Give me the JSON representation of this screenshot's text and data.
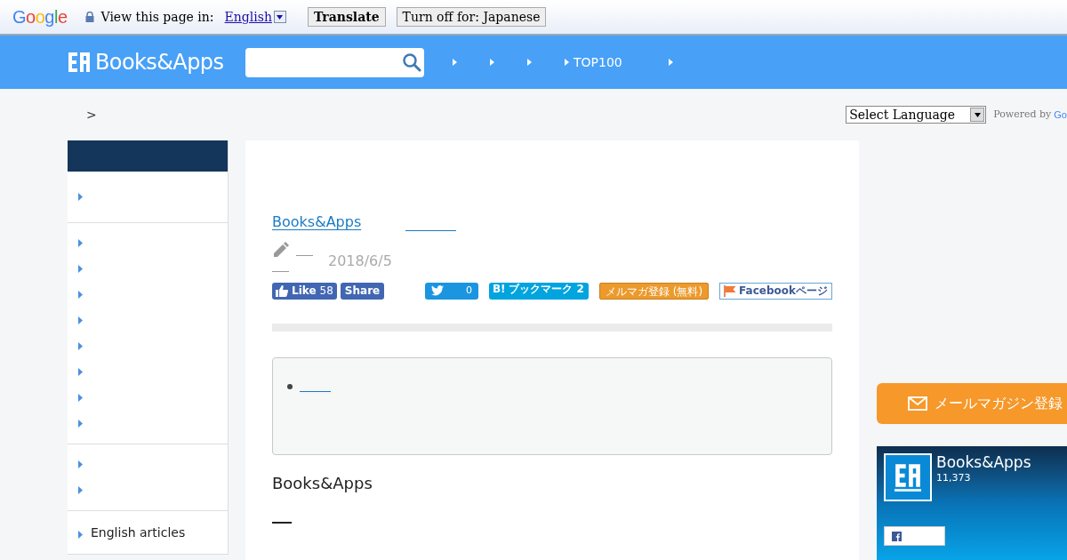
{
  "translate_bar": {
    "google_logo": "Google",
    "prompt": "View this page in:",
    "language": "English",
    "buttons": [
      "Translate",
      "Turn off for: Japanese"
    ]
  },
  "header": {
    "logo": "Books&Apps",
    "nav_label": "TOP100"
  },
  "breadcrumb": {
    "separator": ">"
  },
  "language_select": {
    "value": "Select Language",
    "powered_by": "Powered by",
    "brand": "Go"
  },
  "sidebar": {
    "footer_item": "English articles"
  },
  "article": {
    "site_link": "Books&Apps",
    "date": "2018/6/5",
    "share": {
      "like": "Like",
      "like_count": "58",
      "share": "Share",
      "tweet_count": "0",
      "hatena_logo": "B!",
      "hatena_label": "ブックマーク",
      "hatena_count": "2",
      "mail_magazine": "メルマガ登録 (無料)",
      "facebook_page": "Facebookページ"
    },
    "heading": "Books&Apps"
  },
  "right_column": {
    "newsletter_button": "メールマガジン登録",
    "facebook_box": {
      "name": "Books&Apps",
      "count": "11,373"
    }
  }
}
